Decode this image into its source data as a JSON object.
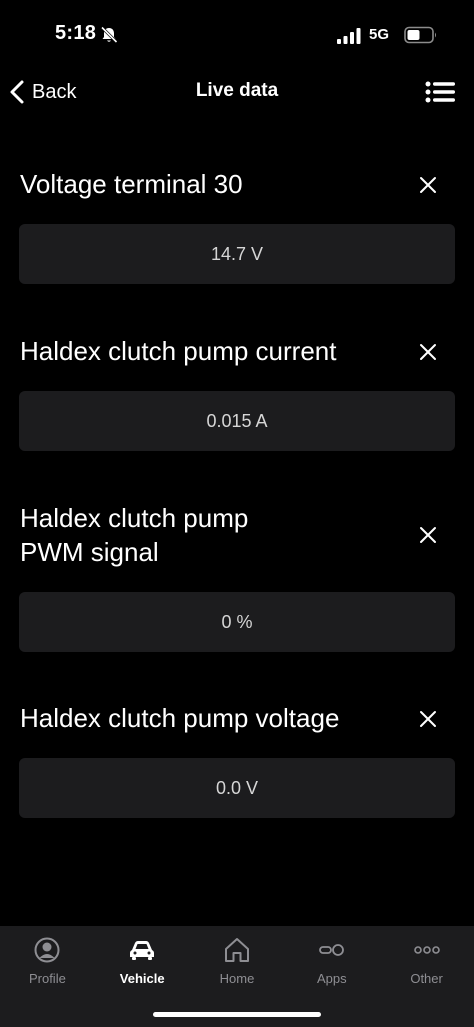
{
  "status_bar": {
    "time": "5:18",
    "network": "5G",
    "icons": [
      "bell-slash-icon",
      "cellular-signal-icon",
      "battery-icon"
    ]
  },
  "nav": {
    "back_label": "Back",
    "title": "Live data",
    "menu_icon": "list-icon"
  },
  "parameters": [
    {
      "title": "Voltage terminal 30",
      "value": "14.7 V"
    },
    {
      "title": "Haldex clutch pump current",
      "value": "0.015 A"
    },
    {
      "title": "Haldex clutch pump PWM signal",
      "value": "0 %"
    },
    {
      "title": "Haldex clutch pump voltage",
      "value": "0.0 V"
    }
  ],
  "tabs": [
    {
      "label": "Profile",
      "icon": "person-circle-icon",
      "active": false
    },
    {
      "label": "Vehicle",
      "icon": "car-icon",
      "active": true
    },
    {
      "label": "Home",
      "icon": "house-icon",
      "active": false
    },
    {
      "label": "Apps",
      "icon": "apps-icon",
      "active": false
    },
    {
      "label": "Other",
      "icon": "more-icon",
      "active": false
    }
  ],
  "colors": {
    "background": "#000000",
    "value_box": "#1c1c1e",
    "tab_bar": "#1c1c1e",
    "inactive_tab": "#8e8e93",
    "active_tab": "#ffffff"
  }
}
